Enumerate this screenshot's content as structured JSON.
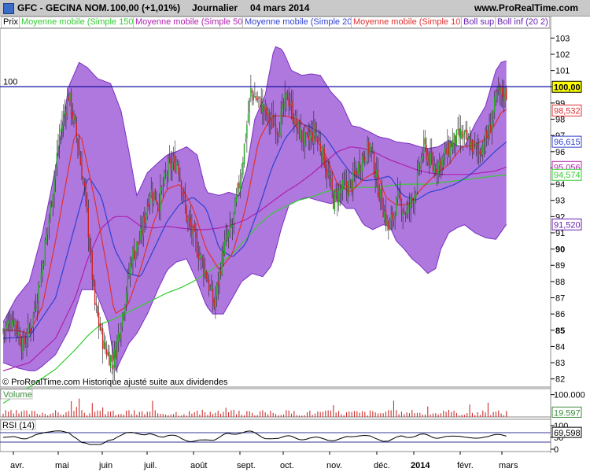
{
  "header": {
    "instrument": "GFC - GECINA NOM.",
    "last": "100,00 (+1,01%)",
    "period": "Journalier",
    "date": "04 mars 2014",
    "site": "www.ProRealTime.com"
  },
  "legend": [
    {
      "label": "Prix",
      "color": "#000000"
    },
    {
      "label": "Moyenne mobile (Simple 150)",
      "color": "#33cc33"
    },
    {
      "label": "Moyenne mobile (Simple 50)",
      "color": "#b020b0"
    },
    {
      "label": "Moyenne mobile (Simple 20)",
      "color": "#3040d0"
    },
    {
      "label": "Moyenne mobile (Simple 10)",
      "color": "#e03030"
    },
    {
      "label": "Boll sup",
      "color": "#6a1fb0"
    },
    {
      "label": "Boll inf (20 2)",
      "color": "#6a1fb0"
    }
  ],
  "footnote": "© ProRealTime.com  Historique ajusté suite aux dividendes",
  "colors": {
    "up": "#22aa22",
    "down": "#cc2222",
    "band_fill": "#a060d8",
    "band_line": "#7a30c0",
    "ma150": "#33cc33",
    "ma50": "#b020b0",
    "ma20": "#3040d0",
    "ma10": "#e03030",
    "hline": "#1010a0",
    "volume": "#cc3030"
  },
  "chart_data": [
    {
      "type": "candlestick",
      "name": "price",
      "ylim": [
        81.5,
        103.6
      ],
      "y_ticks": [
        82,
        83,
        84,
        85,
        86,
        87,
        88,
        89,
        90,
        91,
        92,
        93,
        94,
        95,
        96,
        97,
        98,
        99,
        100,
        101,
        102,
        103
      ],
      "bold_ticks": [
        85,
        90,
        95,
        100
      ],
      "x_month_labels": [
        "avr.",
        "mai",
        "juin",
        "juil.",
        "août",
        "sept.",
        "oct.",
        "nov.",
        "déc.",
        "2014",
        "févr.",
        "mars"
      ],
      "horizontal_line": {
        "value": 100,
        "label": "100"
      },
      "price_tags": [
        {
          "value": 100.0,
          "label": "100,00",
          "color": "#000000",
          "bg": "#ffff00"
        },
        {
          "value": 98.532,
          "label": "98,532",
          "color": "#e03030",
          "bg": "#ffffff"
        },
        {
          "value": 96.615,
          "label": "96,615",
          "color": "#3040d0",
          "bg": "#ffffff"
        },
        {
          "value": 95.056,
          "label": "95,056",
          "color": "#b020b0",
          "bg": "#ffffff"
        },
        {
          "value": 94.574,
          "label": "94,574",
          "color": "#33cc33",
          "bg": "#ffffff"
        },
        {
          "value": 91.52,
          "label": "91,520",
          "color": "#6a1fb0",
          "bg": "#ffffff"
        }
      ],
      "close_path": [
        [
          0,
          85
        ],
        [
          8,
          85.8
        ],
        [
          15,
          84
        ],
        [
          22,
          85.5
        ],
        [
          29,
          88.5
        ],
        [
          36,
          92.5
        ],
        [
          43,
          97
        ],
        [
          50,
          99.5
        ],
        [
          56,
          97
        ],
        [
          63,
          93
        ],
        [
          70,
          86.5
        ],
        [
          77,
          84
        ],
        [
          84,
          83
        ],
        [
          91,
          86
        ],
        [
          98,
          89.5
        ],
        [
          105,
          90.7
        ],
        [
          112,
          93.6
        ],
        [
          119,
          93
        ],
        [
          126,
          95
        ],
        [
          133,
          95.5
        ],
        [
          140,
          92
        ],
        [
          147,
          90.3
        ],
        [
          154,
          88.7
        ],
        [
          161,
          86.5
        ],
        [
          168,
          90
        ],
        [
          175,
          91.5
        ],
        [
          182,
          95
        ],
        [
          189,
          99.7
        ],
        [
          196,
          99
        ],
        [
          203,
          98
        ],
        [
          210,
          97.5
        ],
        [
          217,
          99.5
        ],
        [
          224,
          97.5
        ],
        [
          231,
          96.5
        ],
        [
          238,
          97.3
        ],
        [
          245,
          95.5
        ],
        [
          252,
          93
        ],
        [
          259,
          93.7
        ],
        [
          266,
          94
        ],
        [
          273,
          95.5
        ],
        [
          280,
          96.3
        ],
        [
          287,
          93.5
        ],
        [
          294,
          91.2
        ],
        [
          301,
          93
        ],
        [
          308,
          92.2
        ],
        [
          314,
          93.5
        ],
        [
          321,
          96.3
        ],
        [
          328,
          95
        ],
        [
          335,
          95.5
        ],
        [
          342,
          96.5
        ],
        [
          349,
          97
        ],
        [
          356,
          96.5
        ],
        [
          363,
          96
        ],
        [
          370,
          97
        ],
        [
          377,
          99.5
        ],
        [
          384,
          99.6
        ]
      ],
      "high_low_spread": 0.9,
      "ma10": [
        [
          0,
          85
        ],
        [
          10,
          85
        ],
        [
          20,
          84.8
        ],
        [
          30,
          86.5
        ],
        [
          40,
          90.5
        ],
        [
          50,
          95
        ],
        [
          55,
          97.2
        ],
        [
          60,
          96.8
        ],
        [
          70,
          93
        ],
        [
          80,
          88.5
        ],
        [
          85,
          86
        ],
        [
          95,
          86.5
        ],
        [
          105,
          88.8
        ],
        [
          115,
          91.7
        ],
        [
          125,
          93.7
        ],
        [
          135,
          94
        ],
        [
          145,
          92.5
        ],
        [
          155,
          90
        ],
        [
          165,
          88.7
        ],
        [
          175,
          89.7
        ],
        [
          185,
          92.5
        ],
        [
          195,
          96.7
        ],
        [
          205,
          98.2
        ],
        [
          215,
          98.2
        ],
        [
          225,
          98
        ],
        [
          235,
          97.2
        ],
        [
          245,
          96
        ],
        [
          255,
          94
        ],
        [
          265,
          93.5
        ],
        [
          275,
          94.3
        ],
        [
          285,
          94.8
        ],
        [
          292,
          93.2
        ],
        [
          300,
          92.7
        ],
        [
          310,
          92.8
        ],
        [
          320,
          93.8
        ],
        [
          330,
          94.6
        ],
        [
          340,
          95.2
        ],
        [
          350,
          96.3
        ],
        [
          360,
          96.4
        ],
        [
          370,
          96.9
        ],
        [
          380,
          98.4
        ],
        [
          384,
          98.6
        ]
      ],
      "ma20": [
        [
          0,
          84.5
        ],
        [
          20,
          84.6
        ],
        [
          40,
          87
        ],
        [
          55,
          91.5
        ],
        [
          65,
          94.5
        ],
        [
          75,
          93.2
        ],
        [
          85,
          90
        ],
        [
          95,
          88.5
        ],
        [
          105,
          88.3
        ],
        [
          115,
          90
        ],
        [
          125,
          91.7
        ],
        [
          135,
          92.8
        ],
        [
          145,
          93.2
        ],
        [
          155,
          92.5
        ],
        [
          165,
          90
        ],
        [
          175,
          89.5
        ],
        [
          185,
          90.3
        ],
        [
          195,
          92.5
        ],
        [
          205,
          95
        ],
        [
          215,
          96.8
        ],
        [
          225,
          97.8
        ],
        [
          235,
          97.5
        ],
        [
          245,
          97
        ],
        [
          255,
          95.8
        ],
        [
          265,
          94.7
        ],
        [
          275,
          94.2
        ],
        [
          285,
          94.3
        ],
        [
          295,
          94.5
        ],
        [
          305,
          93.3
        ],
        [
          315,
          93
        ],
        [
          325,
          93.5
        ],
        [
          335,
          93.7
        ],
        [
          345,
          94
        ],
        [
          355,
          94.5
        ],
        [
          365,
          95.2
        ],
        [
          375,
          96
        ],
        [
          384,
          96.6
        ]
      ],
      "ma50": [
        [
          0,
          82.5
        ],
        [
          20,
          83
        ],
        [
          40,
          84.5
        ],
        [
          55,
          87
        ],
        [
          65,
          89.5
        ],
        [
          75,
          91.3
        ],
        [
          85,
          92
        ],
        [
          95,
          92
        ],
        [
          105,
          91.4
        ],
        [
          115,
          91.3
        ],
        [
          125,
          91.4
        ],
        [
          135,
          91.3
        ],
        [
          145,
          91.2
        ],
        [
          155,
          91.2
        ],
        [
          165,
          91.3
        ],
        [
          175,
          91.5
        ],
        [
          185,
          91.8
        ],
        [
          195,
          92.3
        ],
        [
          205,
          92.9
        ],
        [
          215,
          93.5
        ],
        [
          225,
          94
        ],
        [
          235,
          94.6
        ],
        [
          245,
          95.3
        ],
        [
          255,
          96
        ],
        [
          265,
          96.3
        ],
        [
          275,
          96.2
        ],
        [
          285,
          95.9
        ],
        [
          295,
          95.5
        ],
        [
          305,
          95.2
        ],
        [
          315,
          94.9
        ],
        [
          325,
          94.7
        ],
        [
          335,
          94.6
        ],
        [
          345,
          94.6
        ],
        [
          355,
          94.6
        ],
        [
          365,
          94.7
        ],
        [
          375,
          94.8
        ],
        [
          384,
          95.05
        ]
      ],
      "ma150": [
        [
          0,
          80.5
        ],
        [
          20,
          81.5
        ],
        [
          40,
          82.6
        ],
        [
          55,
          83.8
        ],
        [
          65,
          84.7
        ],
        [
          75,
          85.4
        ],
        [
          85,
          85.7
        ],
        [
          95,
          86.1
        ],
        [
          105,
          86.5
        ],
        [
          115,
          86.9
        ],
        [
          125,
          87.3
        ],
        [
          135,
          87.6
        ],
        [
          145,
          88
        ],
        [
          155,
          88.5
        ],
        [
          165,
          89.1
        ],
        [
          175,
          89.7
        ],
        [
          185,
          90.6
        ],
        [
          195,
          91.5
        ],
        [
          205,
          92.2
        ],
        [
          215,
          92.6
        ],
        [
          225,
          93
        ],
        [
          235,
          93.2
        ],
        [
          245,
          93.5
        ],
        [
          255,
          93.7
        ],
        [
          265,
          93.8
        ],
        [
          275,
          93.8
        ],
        [
          285,
          93.8
        ],
        [
          295,
          93.9
        ],
        [
          305,
          94
        ],
        [
          315,
          94
        ],
        [
          325,
          94
        ],
        [
          335,
          94.1
        ],
        [
          345,
          94.2
        ],
        [
          355,
          94.3
        ],
        [
          365,
          94.4
        ],
        [
          375,
          94.5
        ],
        [
          384,
          94.57
        ]
      ],
      "boll_sup": [
        [
          0,
          85.5
        ],
        [
          10,
          87
        ],
        [
          20,
          88
        ],
        [
          30,
          91
        ],
        [
          40,
          95
        ],
        [
          50,
          100
        ],
        [
          58,
          101.5
        ],
        [
          64,
          101.2
        ],
        [
          72,
          100.5
        ],
        [
          82,
          100.2
        ],
        [
          90,
          98.5
        ],
        [
          96,
          96
        ],
        [
          102,
          93.3
        ],
        [
          110,
          94.7
        ],
        [
          118,
          95.3
        ],
        [
          125,
          95.8
        ],
        [
          132,
          96
        ],
        [
          140,
          96.3
        ],
        [
          148,
          95.8
        ],
        [
          155,
          93.5
        ],
        [
          165,
          93.3
        ],
        [
          172,
          93.5
        ],
        [
          180,
          93.3
        ],
        [
          186,
          95
        ],
        [
          192,
          98
        ],
        [
          200,
          99.5
        ],
        [
          207,
          102.5
        ],
        [
          213,
          102.3
        ],
        [
          220,
          101
        ],
        [
          228,
          100.7
        ],
        [
          235,
          100.8
        ],
        [
          242,
          100.7
        ],
        [
          250,
          99.7
        ],
        [
          258,
          99
        ],
        [
          266,
          97.6
        ],
        [
          272,
          97.5
        ],
        [
          280,
          97.2
        ],
        [
          287,
          96.9
        ],
        [
          294,
          96.8
        ],
        [
          300,
          96.6
        ],
        [
          310,
          96.5
        ],
        [
          318,
          96.3
        ],
        [
          324,
          96.2
        ],
        [
          332,
          96.3
        ],
        [
          340,
          96.7
        ],
        [
          346,
          96.4
        ],
        [
          352,
          96.3
        ],
        [
          360,
          97.7
        ],
        [
          368,
          98.8
        ],
        [
          376,
          101
        ],
        [
          380,
          101.5
        ],
        [
          384,
          101.6
        ]
      ],
      "boll_inf": [
        [
          0,
          83
        ],
        [
          10,
          82.7
        ],
        [
          20,
          82.5
        ],
        [
          25,
          82.5
        ],
        [
          30,
          82.8
        ],
        [
          40,
          83.5
        ],
        [
          50,
          85
        ],
        [
          56,
          86.5
        ],
        [
          60,
          87.5
        ],
        [
          70,
          87.5
        ],
        [
          80,
          85.5
        ],
        [
          86,
          82.5
        ],
        [
          90,
          83.2
        ],
        [
          96,
          84.2
        ],
        [
          102,
          84.8
        ],
        [
          110,
          86
        ],
        [
          118,
          87.5
        ],
        [
          125,
          88.7
        ],
        [
          132,
          89.2
        ],
        [
          140,
          89.4
        ],
        [
          148,
          88
        ],
        [
          155,
          86.5
        ],
        [
          160,
          86
        ],
        [
          168,
          86
        ],
        [
          175,
          87
        ],
        [
          182,
          88
        ],
        [
          190,
          88.5
        ],
        [
          198,
          88.3
        ],
        [
          205,
          89
        ],
        [
          212,
          91.2
        ],
        [
          218,
          92.7
        ],
        [
          225,
          93
        ],
        [
          232,
          93.2
        ],
        [
          240,
          93
        ],
        [
          250,
          92.8
        ],
        [
          256,
          93
        ],
        [
          262,
          92.5
        ],
        [
          268,
          92.5
        ],
        [
          275,
          91.5
        ],
        [
          282,
          91.2
        ],
        [
          290,
          91.5
        ],
        [
          295,
          91.4
        ],
        [
          300,
          90.5
        ],
        [
          306,
          90
        ],
        [
          312,
          89.4
        ],
        [
          318,
          89
        ],
        [
          324,
          88.5
        ],
        [
          330,
          88.8
        ],
        [
          334,
          90
        ],
        [
          340,
          91
        ],
        [
          346,
          91.3
        ],
        [
          352,
          91.5
        ],
        [
          360,
          91
        ],
        [
          368,
          90.7
        ],
        [
          376,
          90.6
        ],
        [
          384,
          91.52
        ]
      ]
    },
    {
      "type": "bar",
      "name": "Volume",
      "ylim": [
        0,
        120000
      ],
      "y_ticks": [
        100000
      ],
      "tick_labels": [
        "100.000"
      ],
      "last_value_label": "19.597",
      "last_value": 19597
    },
    {
      "type": "line",
      "name": "RSI (14)",
      "ylim": [
        -10,
        120
      ],
      "y_ticks": [
        0,
        50,
        100
      ],
      "levels": [
        30,
        70
      ],
      "last_value_label": "69,598",
      "last_value": 69.598
    }
  ]
}
